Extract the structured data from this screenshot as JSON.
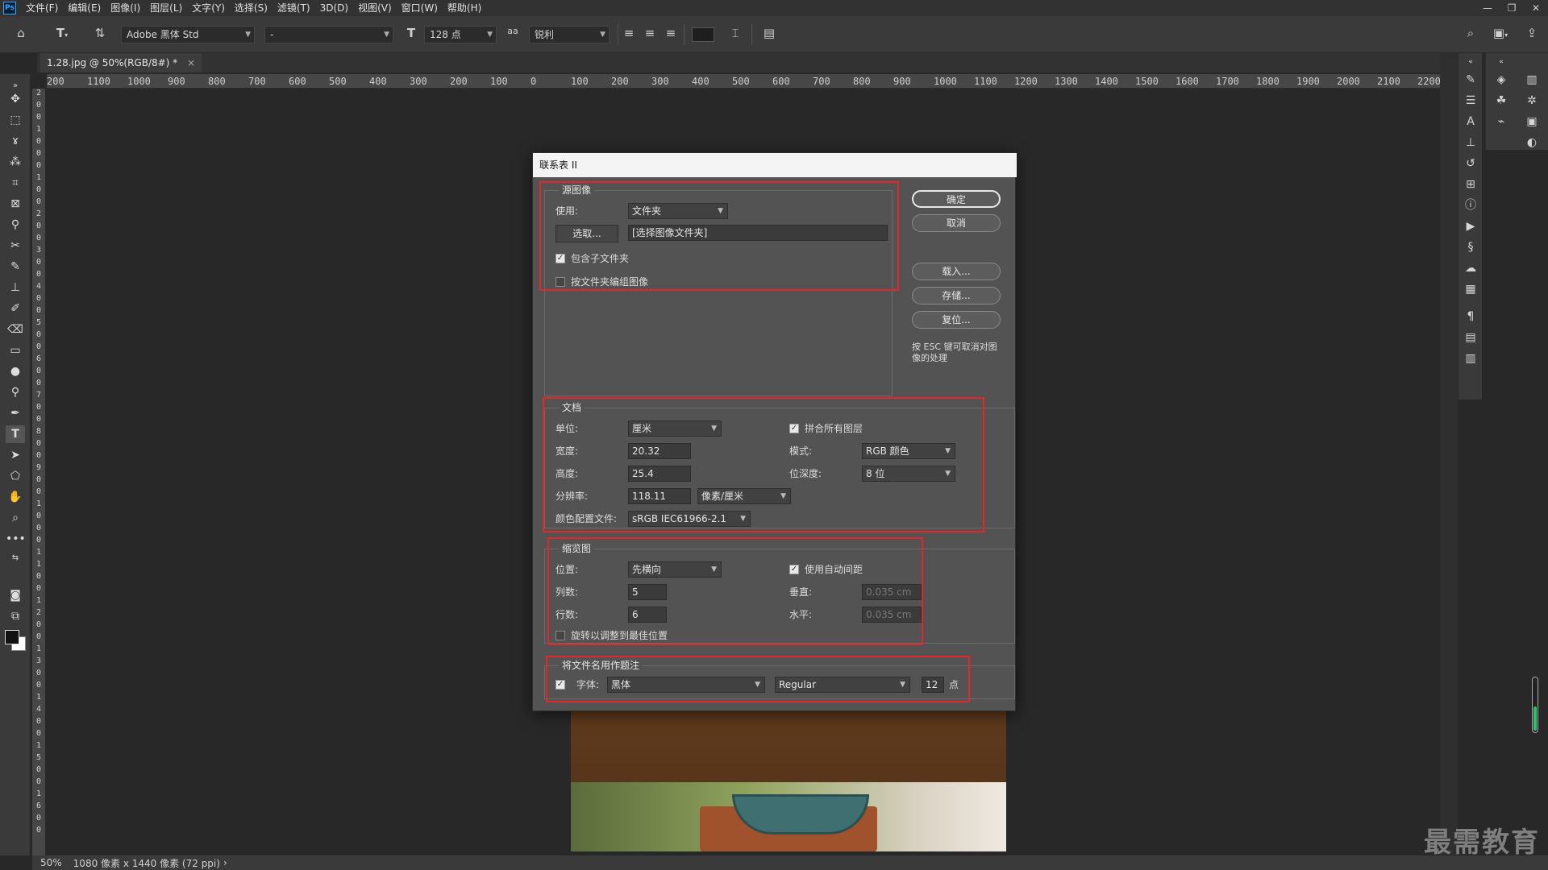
{
  "menubar": {
    "items": [
      "文件(F)",
      "编辑(E)",
      "图像(I)",
      "图层(L)",
      "文字(Y)",
      "选择(S)",
      "滤镜(T)",
      "3D(D)",
      "视图(V)",
      "窗口(W)",
      "帮助(H)"
    ]
  },
  "options": {
    "font_family": "Adobe 黑体 Std",
    "font_style": "-",
    "font_size": "128 点",
    "aa_label": "aa",
    "antialias": "锐利",
    "text_color": "#1e1e1e"
  },
  "document": {
    "tab_title": "1.28.jpg @ 50%(RGB/8#) *",
    "tab_close": "×"
  },
  "ruler": {
    "h_labels": [
      "200",
      "1100",
      "1000",
      "900",
      "800",
      "700",
      "600",
      "500",
      "400",
      "300",
      "200",
      "100",
      "0",
      "100",
      "200",
      "300",
      "400",
      "500",
      "600",
      "700",
      "800",
      "900",
      "1000",
      "1100",
      "1200",
      "1300",
      "1400",
      "1500",
      "1600",
      "1700",
      "1800",
      "1900",
      "2000",
      "2100",
      "2200"
    ],
    "v_labels": [
      "2",
      "0",
      "0",
      "1",
      "0",
      "0",
      "0",
      "1",
      "0",
      "0",
      "2",
      "0",
      "0",
      "3",
      "0",
      "0",
      "4",
      "0",
      "0",
      "5",
      "0",
      "0",
      "6",
      "0",
      "0",
      "7",
      "0",
      "0",
      "8",
      "0",
      "0",
      "9",
      "0",
      "0",
      "1",
      "0",
      "0",
      "0",
      "1",
      "1",
      "0",
      "0",
      "1",
      "2",
      "0",
      "0",
      "1",
      "3",
      "0",
      "0",
      "1",
      "4",
      "0",
      "0",
      "1",
      "5",
      "0",
      "0",
      "1",
      "6",
      "0",
      "0"
    ]
  },
  "status": {
    "zoom": "50%",
    "doc_info": "1080 像素 x 1440 像素 (72 ppi)",
    "arrow": "›"
  },
  "watermark": "最需教育",
  "dialog": {
    "title": "联系表 II",
    "source": {
      "group_label": "源图像",
      "use_label": "使用:",
      "use_value": "文件夹",
      "choose_button": "选取...",
      "path_value": "[选择图像文件夹]",
      "include_subfolders": "包含子文件夹",
      "group_by_folder": "按文件夹编组图像"
    },
    "doc": {
      "group_label": "文档",
      "units_label": "单位:",
      "units_value": "厘米",
      "flatten_label": "拼合所有图层",
      "width_label": "宽度:",
      "width_value": "20.32",
      "mode_label": "模式:",
      "mode_value": "RGB 颜色",
      "height_label": "高度:",
      "height_value": "25.4",
      "depth_label": "位深度:",
      "depth_value": "8 位",
      "resolution_label": "分辨率:",
      "resolution_value": "118.11",
      "res_unit_value": "像素/厘米",
      "profile_label": "颜色配置文件:",
      "profile_value": "sRGB IEC61966-2.1"
    },
    "thumbs": {
      "group_label": "缩览图",
      "place_label": "位置:",
      "place_value": "先横向",
      "auto_spacing_label": "使用自动间距",
      "cols_label": "列数:",
      "cols_value": "5",
      "vert_label": "垂直:",
      "vert_value": "0.035 cm",
      "rows_label": "行数:",
      "rows_value": "6",
      "horiz_label": "水平:",
      "horiz_value": "0.035 cm",
      "rotate_label": "旋转以调整到最佳位置"
    },
    "caption": {
      "group_label": "将文件名用作题注",
      "font_label": "字体:",
      "font_value": "黑体",
      "style_value": "Regular",
      "size_value": "12",
      "size_unit": "点"
    },
    "buttons": {
      "ok": "确定",
      "cancel": "取消",
      "load": "载入...",
      "save": "存储...",
      "reset": "复位..."
    },
    "hint": "按 ESC 键可取消对图像的处理",
    "highlight_color": "#e4262a"
  }
}
